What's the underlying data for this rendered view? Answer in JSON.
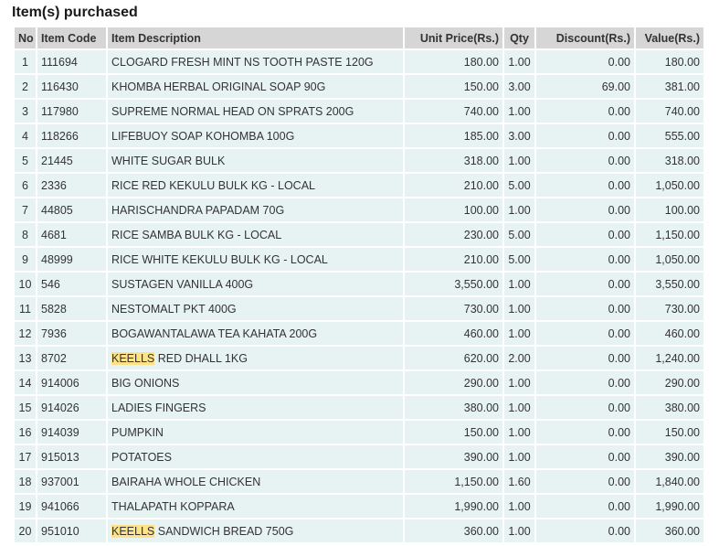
{
  "section_title": "Item(s) purchased",
  "columns": {
    "no": "No",
    "item_code": "Item Code",
    "description": "Item Description",
    "unit_price": "Unit Price(Rs.)",
    "qty": "Qty",
    "discount": "Discount(Rs.)",
    "value": "Value(Rs.)"
  },
  "highlight_color": "#fde28a",
  "rows": [
    {
      "no": "1",
      "code": "111694",
      "hl": "",
      "desc": "CLOGARD FRESH MINT NS TOOTH PASTE 120G",
      "price": "180.00",
      "qty": "1.00",
      "discount": "0.00",
      "value": "180.00"
    },
    {
      "no": "2",
      "code": "116430",
      "hl": "",
      "desc": "KHOMBA HERBAL ORIGINAL SOAP 90G",
      "price": "150.00",
      "qty": "3.00",
      "discount": "69.00",
      "value": "381.00"
    },
    {
      "no": "3",
      "code": "117980",
      "hl": "",
      "desc": "SUPREME NORMAL HEAD ON SPRATS 200G",
      "price": "740.00",
      "qty": "1.00",
      "discount": "0.00",
      "value": "740.00"
    },
    {
      "no": "4",
      "code": "118266",
      "hl": "",
      "desc": "LIFEBUOY SOAP KOHOMBA 100G",
      "price": "185.00",
      "qty": "3.00",
      "discount": "0.00",
      "value": "555.00"
    },
    {
      "no": "5",
      "code": "21445",
      "hl": "",
      "desc": "WHITE SUGAR BULK",
      "price": "318.00",
      "qty": "1.00",
      "discount": "0.00",
      "value": "318.00"
    },
    {
      "no": "6",
      "code": "2336",
      "hl": "",
      "desc": "RICE RED KEKULU BULK KG - LOCAL",
      "price": "210.00",
      "qty": "5.00",
      "discount": "0.00",
      "value": "1,050.00"
    },
    {
      "no": "7",
      "code": "44805",
      "hl": "",
      "desc": "HARISCHANDRA PAPADAM 70G",
      "price": "100.00",
      "qty": "1.00",
      "discount": "0.00",
      "value": "100.00"
    },
    {
      "no": "8",
      "code": "4681",
      "hl": "",
      "desc": "RICE SAMBA BULK KG - LOCAL",
      "price": "230.00",
      "qty": "5.00",
      "discount": "0.00",
      "value": "1,150.00"
    },
    {
      "no": "9",
      "code": "48999",
      "hl": "",
      "desc": "RICE WHITE KEKULU BULK KG - LOCAL",
      "price": "210.00",
      "qty": "5.00",
      "discount": "0.00",
      "value": "1,050.00"
    },
    {
      "no": "10",
      "code": "546",
      "hl": "",
      "desc": "SUSTAGEN VANILLA 400G",
      "price": "3,550.00",
      "qty": "1.00",
      "discount": "0.00",
      "value": "3,550.00"
    },
    {
      "no": "11",
      "code": "5828",
      "hl": "",
      "desc": "NESTOMALT PKT 400G",
      "price": "730.00",
      "qty": "1.00",
      "discount": "0.00",
      "value": "730.00"
    },
    {
      "no": "12",
      "code": "7936",
      "hl": "",
      "desc": "BOGAWANTALAWA TEA KAHATA 200G",
      "price": "460.00",
      "qty": "1.00",
      "discount": "0.00",
      "value": "460.00"
    },
    {
      "no": "13",
      "code": "8702",
      "hl": "KEELLS",
      "desc": " RED DHALL 1KG",
      "price": "620.00",
      "qty": "2.00",
      "discount": "0.00",
      "value": "1,240.00"
    },
    {
      "no": "14",
      "code": "914006",
      "hl": "",
      "desc": "BIG ONIONS",
      "price": "290.00",
      "qty": "1.00",
      "discount": "0.00",
      "value": "290.00"
    },
    {
      "no": "15",
      "code": "914026",
      "hl": "",
      "desc": "LADIES FINGERS",
      "price": "380.00",
      "qty": "1.00",
      "discount": "0.00",
      "value": "380.00"
    },
    {
      "no": "16",
      "code": "914039",
      "hl": "",
      "desc": "PUMPKIN",
      "price": "150.00",
      "qty": "1.00",
      "discount": "0.00",
      "value": "150.00"
    },
    {
      "no": "17",
      "code": "915013",
      "hl": "",
      "desc": "POTATOES",
      "price": "390.00",
      "qty": "1.00",
      "discount": "0.00",
      "value": "390.00"
    },
    {
      "no": "18",
      "code": "937001",
      "hl": "",
      "desc": "BAIRAHA WHOLE CHICKEN",
      "price": "1,150.00",
      "qty": "1.60",
      "discount": "0.00",
      "value": "1,840.00"
    },
    {
      "no": "19",
      "code": "941066",
      "hl": "",
      "desc": "THALAPATH KOPPARA",
      "price": "1,990.00",
      "qty": "1.00",
      "discount": "0.00",
      "value": "1,990.00"
    },
    {
      "no": "20",
      "code": "951010",
      "hl": "KEELLS",
      "desc": " SANDWICH BREAD 750G",
      "price": "360.00",
      "qty": "1.00",
      "discount": "0.00",
      "value": "360.00"
    }
  ]
}
